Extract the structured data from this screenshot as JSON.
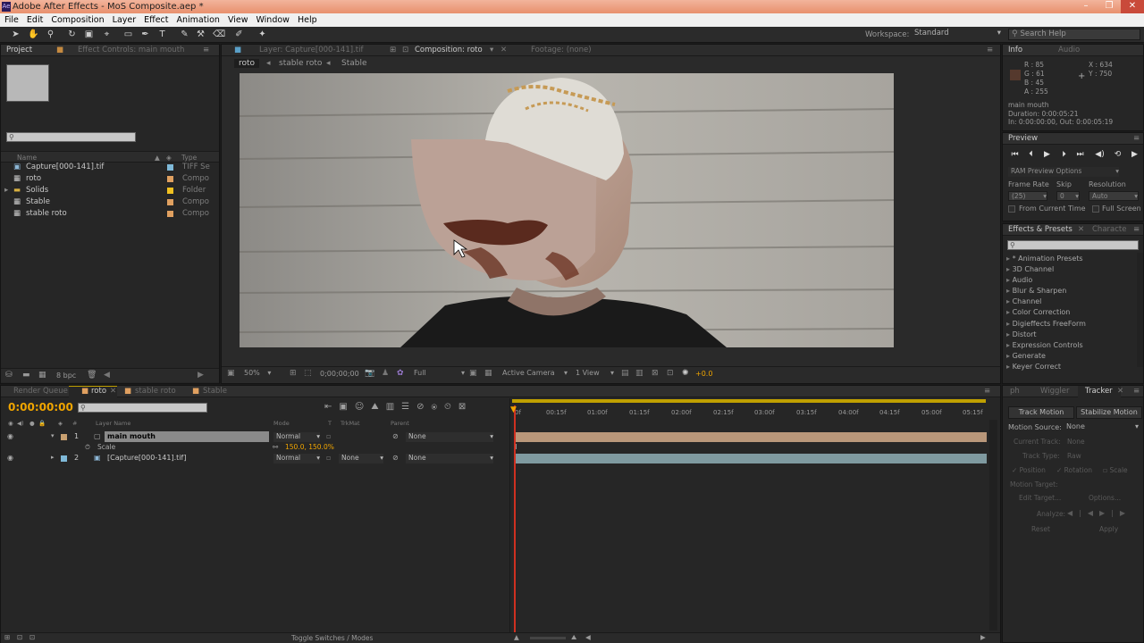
{
  "window": {
    "title": "Adobe After Effects - MoS Composite.aep *",
    "logo": "Ae"
  },
  "menu": [
    "File",
    "Edit",
    "Composition",
    "Layer",
    "Effect",
    "Animation",
    "View",
    "Window",
    "Help"
  ],
  "toolbar": {
    "workspace_label": "Workspace:",
    "workspace_value": "Standard",
    "search_placeholder": "Search Help"
  },
  "project_panel": {
    "tabs": [
      "Project",
      "Effect Controls: main mouth"
    ],
    "col_name": "Name",
    "col_type": "Type",
    "items": [
      {
        "name": "Capture[000-141].tif",
        "type": "TIFF Se",
        "color": "#7fb9d8"
      },
      {
        "name": "roto",
        "type": "Compo",
        "color": "#e0a060"
      },
      {
        "name": "Solids",
        "type": "Folder",
        "color": "#f0c020"
      },
      {
        "name": "Stable",
        "type": "Compo",
        "color": "#e0a060"
      },
      {
        "name": "stable roto",
        "type": "Compo",
        "color": "#e0a060"
      }
    ],
    "bpc": "8 bpc"
  },
  "viewer": {
    "tabs": {
      "layer": "Layer: Capture[000-141].tif",
      "composition": "Composition: roto",
      "footage": "Footage: (none)"
    },
    "breadcrumbs": [
      "roto",
      "stable roto",
      "Stable"
    ],
    "zoom": "50%",
    "timecode": "0;00;00;00",
    "resolution": "Full",
    "camera": "Active Camera",
    "views": "1 View",
    "exposure": "+0.0"
  },
  "info_panel": {
    "tabs": [
      "Info",
      "Audio"
    ],
    "r": "R : 85",
    "g": "G : 61",
    "b": "B : 45",
    "a": "A : 255",
    "x": "X : 634",
    "y": "Y : 750",
    "layer_name": "main mouth",
    "duration": "Duration: 0:00:05:21",
    "in_out": "In: 0:00:00:00, Out: 0:00:05:19",
    "swatch": "#55392d"
  },
  "preview_panel": {
    "title": "Preview",
    "ram_options": "RAM Preview Options",
    "frame_rate_label": "Frame Rate",
    "skip_label": "Skip",
    "resolution_label": "Resolution",
    "frame_rate": "(25)",
    "skip": "0",
    "resolution": "Auto",
    "from_current": "From Current Time",
    "full_screen": "Full Screen"
  },
  "effects_panel": {
    "tabs": [
      "Effects & Presets",
      "Characte"
    ],
    "items": [
      "* Animation Presets",
      "3D Channel",
      "Audio",
      "Blur & Sharpen",
      "Channel",
      "Color Correction",
      "Digieffects FreeForm",
      "Distort",
      "Expression Controls",
      "Generate",
      "Keyer Correct"
    ]
  },
  "timeline": {
    "tabs": [
      "Render Queue",
      "roto",
      "stable roto",
      "Stable"
    ],
    "timecode": "0:00:00:00",
    "columns": {
      "layer_name": "Layer Name",
      "mode": "Mode",
      "t": "T",
      "trkmat": "TrkMat",
      "parent": "Parent"
    },
    "layers": [
      {
        "num": "1",
        "name": "main mouth",
        "mode": "Normal",
        "trkmat": "",
        "parent": "None",
        "color": "#c8a070"
      },
      {
        "num": "2",
        "name": "[Capture[000-141].tif]",
        "mode": "Normal",
        "trkmat": "None",
        "parent": "None",
        "color": "#7fb9d8"
      }
    ],
    "scale_label": "Scale",
    "scale_value": "150.0, 150.0%",
    "ruler": [
      "0f",
      "00:15f",
      "01:00f",
      "01:15f",
      "02:00f",
      "02:15f",
      "03:00f",
      "03:15f",
      "04:00f",
      "04:15f",
      "05:00f",
      "05:15f"
    ],
    "toggle": "Toggle Switches / Modes"
  },
  "tracker": {
    "tabs": [
      "ph",
      "Wiggler",
      "Tracker"
    ],
    "track_motion": "Track Motion",
    "stabilize_motion": "Stabilize Motion",
    "motion_source_label": "Motion Source:",
    "motion_source": "None",
    "current_track": "Current Track:",
    "current_track_val": "None",
    "track_type": "Track Type:",
    "track_type_val": "Raw",
    "position": "Position",
    "rotation": "Rotation",
    "scale": "Scale",
    "motion_target": "Motion Target:",
    "edit_target": "Edit Target...",
    "options": "Options...",
    "analyze": "Analyze:",
    "reset": "Reset",
    "apply": "Apply"
  }
}
